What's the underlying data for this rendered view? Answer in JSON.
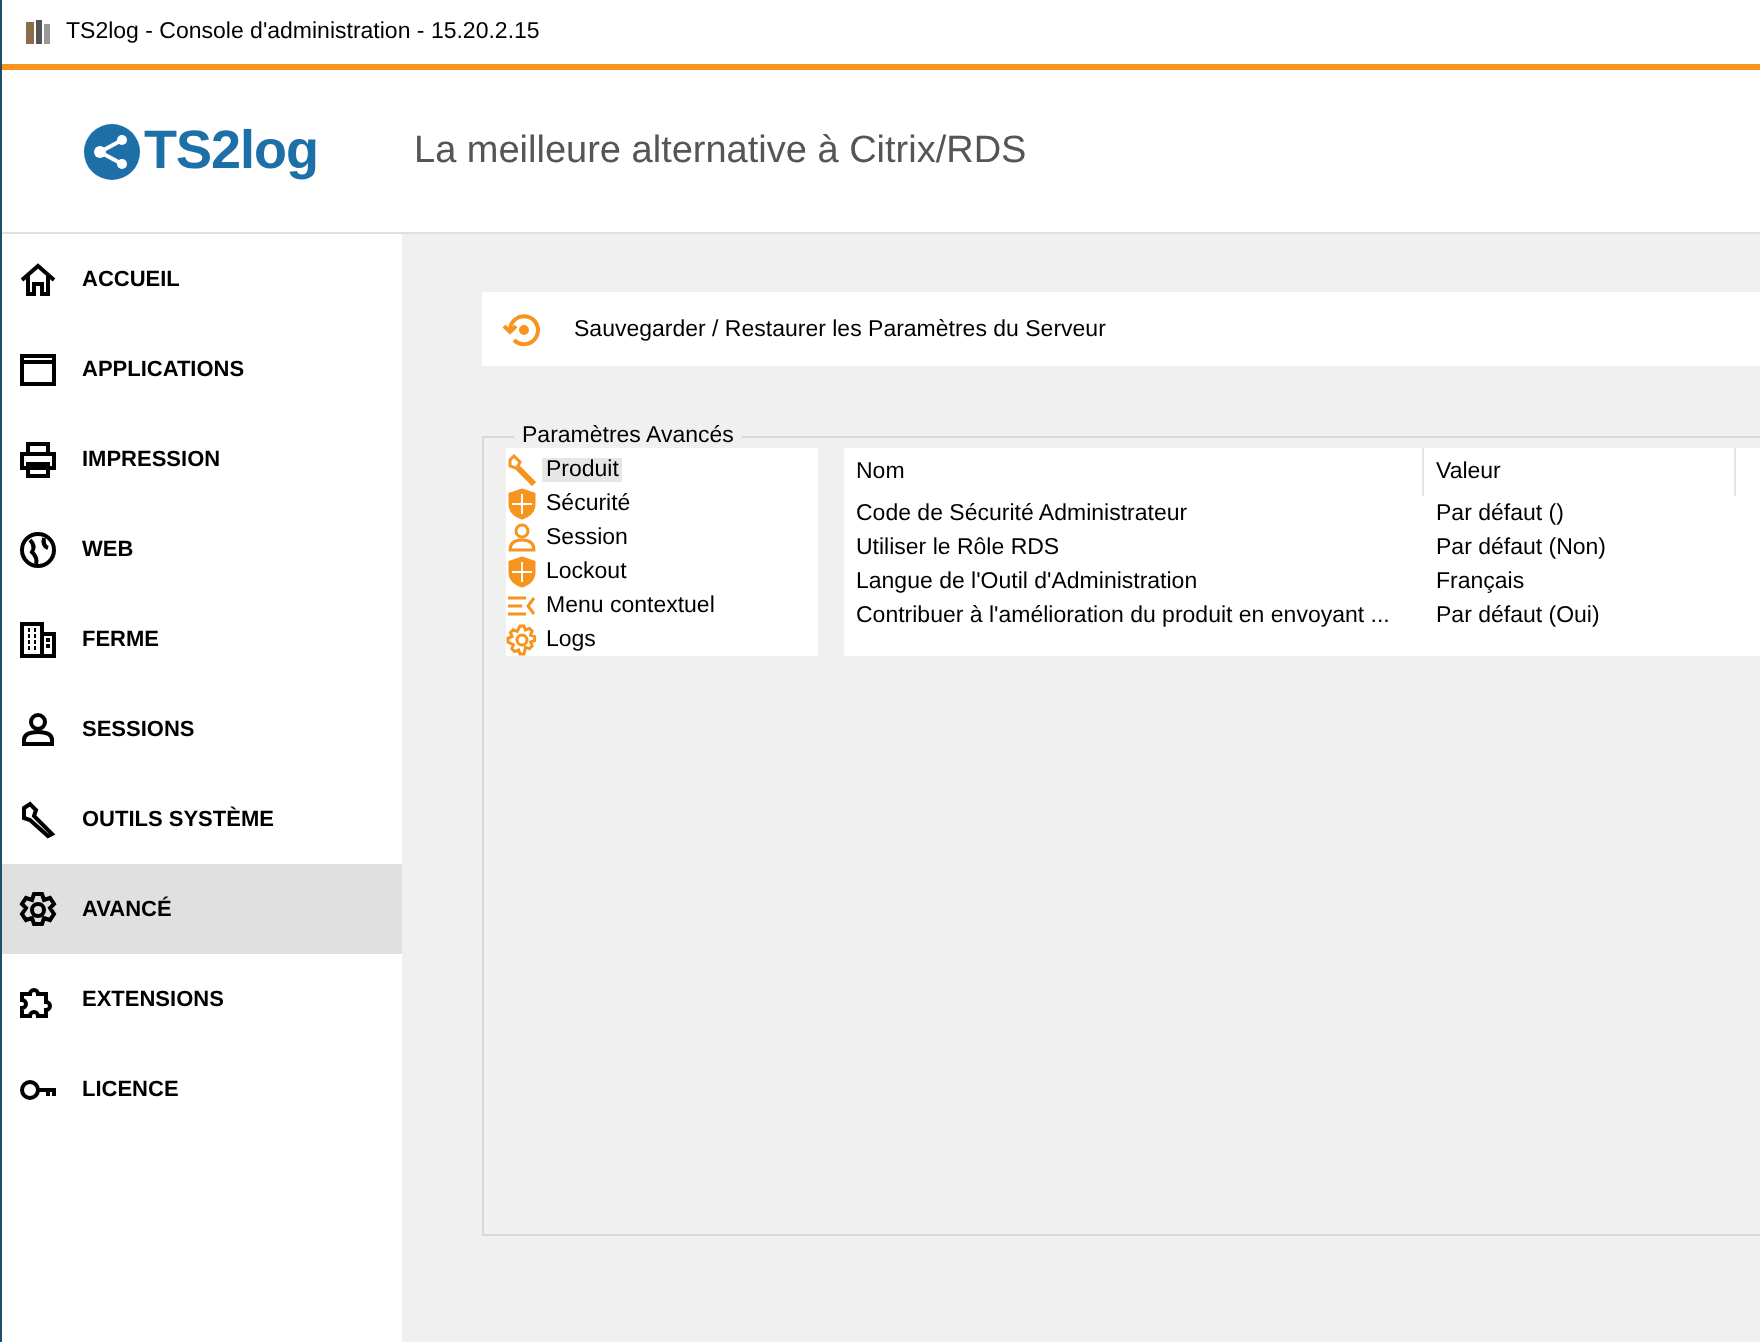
{
  "window": {
    "title": "TS2log - Console d'administration - 15.20.2.15"
  },
  "header": {
    "logo": "TS2log",
    "tagline": "La meilleure alternative à Citrix/RDS"
  },
  "sidebar": {
    "items": [
      {
        "label": "ACCUEIL",
        "selected": false
      },
      {
        "label": "APPLICATIONS",
        "selected": false
      },
      {
        "label": "IMPRESSION",
        "selected": false
      },
      {
        "label": "WEB",
        "selected": false
      },
      {
        "label": "FERME",
        "selected": false
      },
      {
        "label": "SESSIONS",
        "selected": false
      },
      {
        "label": "OUTILS SYSTÈME",
        "selected": false
      },
      {
        "label": "AVANCÉ",
        "selected": true
      },
      {
        "label": "EXTENSIONS",
        "selected": false
      },
      {
        "label": "LICENCE",
        "selected": false
      }
    ]
  },
  "backup_bar": {
    "label": "Sauvegarder / Restaurer les Paramètres du Serveur"
  },
  "advanced": {
    "title": "Paramètres Avancés",
    "tree": [
      {
        "label": "Produit",
        "selected": true
      },
      {
        "label": "Sécurité",
        "selected": false
      },
      {
        "label": "Session",
        "selected": false
      },
      {
        "label": "Lockout",
        "selected": false
      },
      {
        "label": "Menu contextuel",
        "selected": false
      },
      {
        "label": "Logs",
        "selected": false
      }
    ],
    "table": {
      "columns": [
        "Nom",
        "Valeur"
      ],
      "rows": [
        [
          "Code de Sécurité Administrateur",
          "Par défaut ()"
        ],
        [
          "Utiliser le Rôle RDS",
          "Par défaut (Non)"
        ],
        [
          "Langue de l'Outil d'Administration",
          "Français"
        ],
        [
          "Contribuer à l'amélioration du produit en envoyant ...",
          "Par défaut (Oui)"
        ]
      ]
    }
  }
}
